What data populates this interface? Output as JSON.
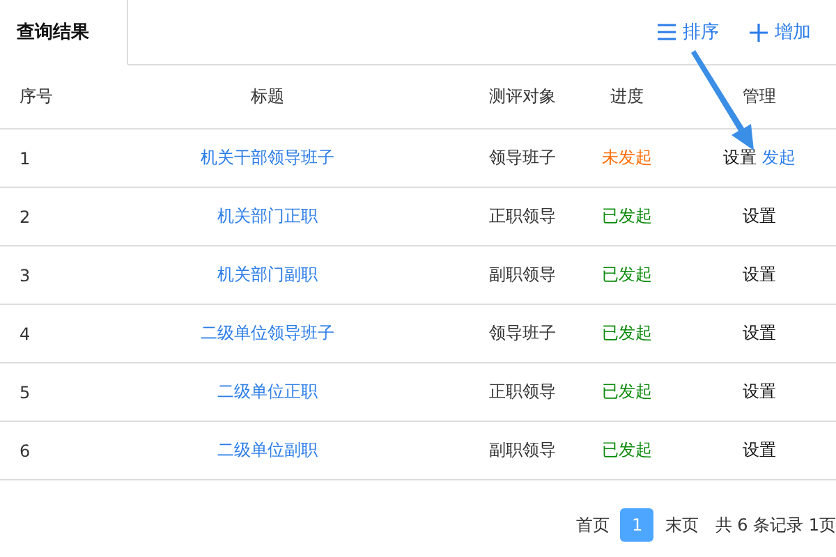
{
  "tabs": [
    {
      "label": "查询结果",
      "selected": true
    }
  ],
  "toolbar": [
    {
      "kind": "sort",
      "label": "排序"
    },
    {
      "kind": "add",
      "label": "增加"
    }
  ],
  "table": {
    "columns": [
      "序号",
      "标题",
      "测评对象",
      "进度",
      "管理"
    ],
    "rows": [
      {
        "index": "1",
        "title": "机关干部领导班子",
        "target": "领导班子",
        "status": {
          "kind": "not_started",
          "label": "未发起"
        },
        "actions": [
          {
            "kind": "plain",
            "label": "设置"
          },
          {
            "kind": "link",
            "label": "发起"
          }
        ]
      },
      {
        "index": "2",
        "title": "机关部门正职",
        "target": "正职领导",
        "status": {
          "kind": "started",
          "label": "已发起"
        },
        "actions": [
          {
            "kind": "plain",
            "label": "设置"
          }
        ]
      },
      {
        "index": "3",
        "title": "机关部门副职",
        "target": "副职领导",
        "status": {
          "kind": "started",
          "label": "已发起"
        },
        "actions": [
          {
            "kind": "plain",
            "label": "设置"
          }
        ]
      },
      {
        "index": "4",
        "title": "二级单位领导班子",
        "target": "领导班子",
        "status": {
          "kind": "started",
          "label": "已发起"
        },
        "actions": [
          {
            "kind": "plain",
            "label": "设置"
          }
        ]
      },
      {
        "index": "5",
        "title": "二级单位正职",
        "target": "正职领导",
        "status": {
          "kind": "started",
          "label": "已发起"
        },
        "actions": [
          {
            "kind": "plain",
            "label": "设置"
          }
        ]
      },
      {
        "index": "6",
        "title": "二级单位副职",
        "target": "副职领导",
        "status": {
          "kind": "started",
          "label": "已发起"
        },
        "actions": [
          {
            "kind": "plain",
            "label": "设置"
          }
        ]
      }
    ]
  },
  "pagination": {
    "first": "首页",
    "pages": [
      {
        "label": "1",
        "selected": true
      }
    ],
    "last": "末页",
    "summary": "共 6 条记录 1页"
  },
  "callout_arrow": true
}
